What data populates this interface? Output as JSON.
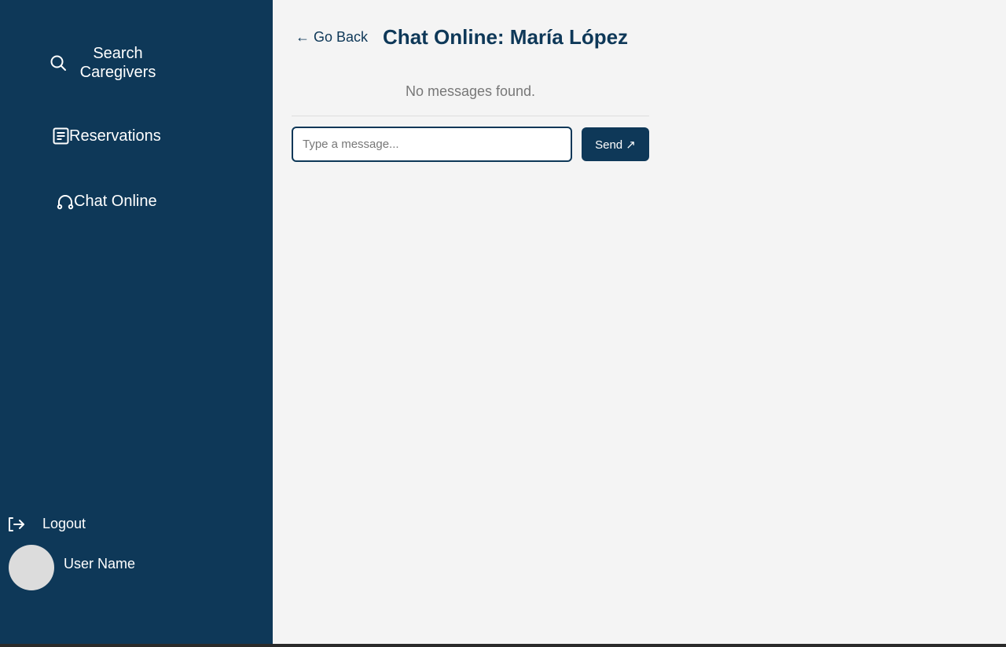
{
  "sidebar": {
    "items": [
      {
        "label": "Search Caregivers",
        "icon": "search-icon"
      },
      {
        "label": "Reservations",
        "icon": "document-icon"
      },
      {
        "label": "Chat Online",
        "icon": "headset-icon"
      }
    ],
    "logout_label": "Logout",
    "logout_icon": "logout-icon",
    "user_name": "User Name"
  },
  "header": {
    "back_label": "← Go Back",
    "title": "Chat Online: María López"
  },
  "chat": {
    "empty_message": "No messages found.",
    "input_value": "",
    "input_placeholder": "Type a message...",
    "send_label": "Send ↗"
  },
  "colors": {
    "sidebar_bg": "#0e3858",
    "accent": "#0e3858",
    "page_bg": "#f4f4f4",
    "muted_text": "#777777"
  }
}
